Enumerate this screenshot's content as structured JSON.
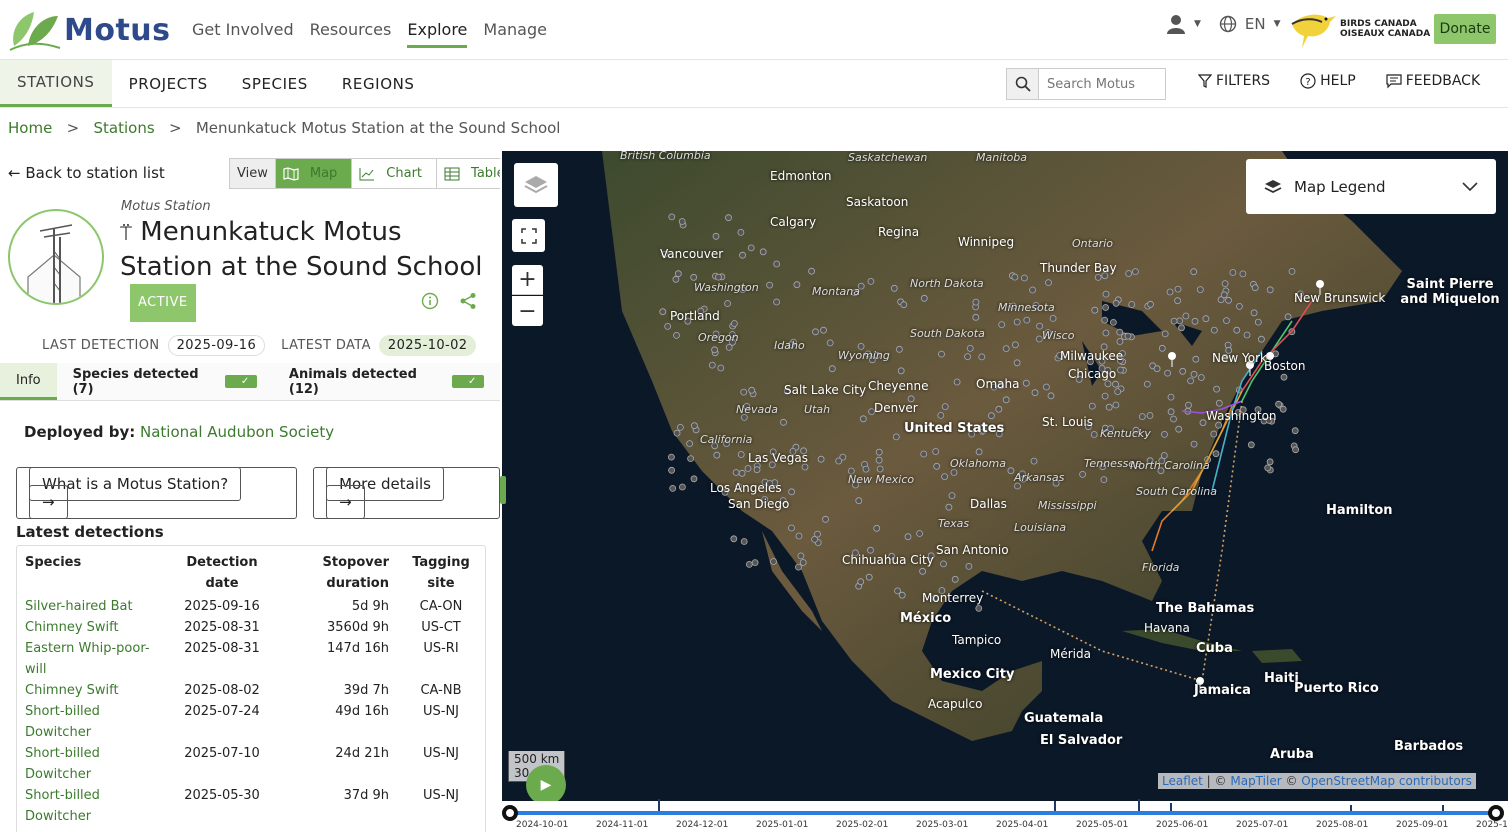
{
  "brand": {
    "name": "Motus"
  },
  "mainnav": [
    "Get Involved",
    "Resources",
    "Explore",
    "Manage"
  ],
  "lang": "EN",
  "partner": {
    "line1": "BIRDS CANADA",
    "line2": "OISEAUX CANADA"
  },
  "donate": "Donate",
  "subtabs": [
    "STATIONS",
    "PROJECTS",
    "SPECIES",
    "REGIONS"
  ],
  "search": {
    "placeholder": "Search Motus"
  },
  "subactions": {
    "filters": "FILTERS",
    "help": "HELP",
    "feedback": "FEEDBACK"
  },
  "breadcrumb": {
    "home": "Home",
    "stations": "Stations",
    "current": "Menunkatuck Motus Station at the Sound School"
  },
  "back": "Back to station list",
  "view": {
    "label": "View",
    "map": "Map",
    "chart": "Chart",
    "table": "Table"
  },
  "station": {
    "type": "Motus Station",
    "name": "Menunkatuck Motus Station at the Sound School",
    "status": "ACTIVE"
  },
  "stats": {
    "last_detection_label": "LAST DETECTION",
    "last_detection": "2025-09-16",
    "latest_data_label": "LATEST DATA",
    "latest_data": "2025-10-02"
  },
  "tabs": {
    "info": "Info",
    "species": "Species detected (7)",
    "animals": "Animals detected (12)"
  },
  "deployed": {
    "label": "Deployed by:",
    "org": "National Audubon Society"
  },
  "buttons": {
    "what": "What is a Motus Station?",
    "more": "More details"
  },
  "latest_title": "Latest detections",
  "table": {
    "headers": [
      "Species",
      "Detection date",
      "Stopover duration",
      "Tagging site"
    ],
    "rows": [
      [
        "Silver-haired Bat",
        "2025-09-16",
        "5d 9h",
        "CA-ON"
      ],
      [
        "Chimney Swift",
        "2025-08-31",
        "3560d 9h",
        "US-CT"
      ],
      [
        "Eastern Whip-poor-will",
        "2025-08-31",
        "147d 16h",
        "US-RI"
      ],
      [
        "Chimney Swift",
        "2025-08-02",
        "39d 7h",
        "CA-NB"
      ],
      [
        "Short-billed Dowitcher",
        "2025-07-24",
        "49d 16h",
        "US-NJ"
      ],
      [
        "Short-billed Dowitcher",
        "2025-07-10",
        "24d 21h",
        "US-NJ"
      ],
      [
        "Short-billed Dowitcher",
        "2025-05-30",
        "37d 9h",
        "US-NJ"
      ]
    ]
  },
  "map": {
    "legend": "Map Legend",
    "scale": "500 km",
    "scale2": "30",
    "attribution": {
      "leaflet": "Leaflet",
      "sep1": " | © ",
      "maptiler": "MapTiler",
      "sep2": " © ",
      "osm": "OpenStreetMap contributors"
    },
    "labels": {
      "british_columbia": "British Columbia",
      "saskatchewan": "Saskatchewan",
      "manitoba": "Manitoba",
      "edmonton": "Edmonton",
      "calgary": "Calgary",
      "saskatoon": "Saskatoon",
      "regina": "Regina",
      "winnipeg": "Winnipeg",
      "ontario": "Ontario",
      "vancouver": "Vancouver",
      "thunder_bay": "Thunder Bay",
      "washington": "Washington",
      "montana": "Montana",
      "north_dakota": "North Dakota",
      "minnesota": "Minnesota",
      "portland": "Portland",
      "oregon": "Oregon",
      "idaho": "Idaho",
      "south_dakota": "South Dakota",
      "wisconsin": "Wisco",
      "wyoming": "Wyoming",
      "milwaukee": "Milwaukee",
      "chicago": "Chicago",
      "salt_lake": "Salt Lake City",
      "cheyenne": "Cheyenne",
      "omaha": "Omaha",
      "nevada": "Nevada",
      "utah": "Utah",
      "denver": "Denver",
      "united_states": "United States",
      "st_louis": "St. Louis",
      "kentucky": "Kentucky",
      "california": "California",
      "las_vegas": "Las Vegas",
      "oklahoma": "Oklahoma",
      "tennessee": "Tennessee",
      "north_carolina": "North Carolina",
      "los_angeles": "Los Angeles",
      "arkansas": "Arkansas",
      "new_mexico": "New Mexico",
      "san_diego": "San Diego",
      "dallas": "Dallas",
      "mississippi": "Mississippi",
      "south_carolina": "South Carolina",
      "texas": "Texas",
      "louisiana": "Louisiana",
      "chihuahua": "Chihuahua City",
      "san_antonio": "San Antonio",
      "florida": "Florida",
      "monterrey": "Monterrey",
      "bahamas": "The Bahamas",
      "mexico": "México",
      "havana": "Havana",
      "tampico": "Tampico",
      "merida": "Mérida",
      "cuba": "Cuba",
      "mexico_city": "Mexico City",
      "haiti": "Haiti",
      "jamaica": "Jamaica",
      "puerto_rico": "Puerto Rico",
      "acapulco": "Acapulco",
      "guatemala": "Guatemala",
      "el_salvador": "El Salvador",
      "aruba": "Aruba",
      "barbados": "Barbados",
      "hamilton": "Hamilton",
      "saint_pierre": "Saint Pierre and Miquelon",
      "new_brunswick": "New Brunswick",
      "new_york": "New York",
      "boston": "Boston",
      "washington_dc": "Washington"
    },
    "timeline": [
      "2024-10-01",
      "2024-11-01",
      "2024-12-01",
      "2025-01-01",
      "2025-02-01",
      "2025-03-01",
      "2025-04-01",
      "2025-05-01",
      "2025-06-01",
      "2025-07-01",
      "2025-08-01",
      "2025-09-01",
      "2025-1"
    ]
  },
  "colors": {
    "accent": "#6cab4d",
    "brand_blue": "#2f4a8a",
    "link": "#3c7a2e"
  }
}
